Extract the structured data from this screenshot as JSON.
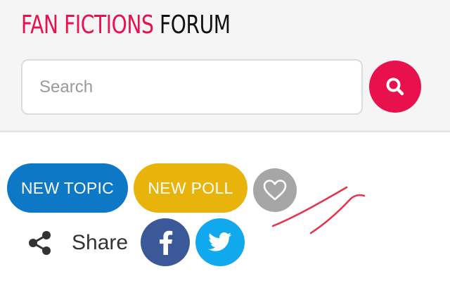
{
  "header": {
    "logo_part1": "FAN FICTIONS",
    "logo_part2": "FORUM",
    "search": {
      "placeholder": "Search",
      "value": ""
    },
    "search_button_icon": "search-icon"
  },
  "actions": {
    "new_topic_label": "NEW TOPIC",
    "new_poll_label": "NEW POLL",
    "favorite_icon": "heart-icon"
  },
  "share": {
    "label": "Share",
    "icon": "share-icon",
    "networks": [
      "facebook-icon",
      "twitter-icon"
    ]
  },
  "colors": {
    "brand_red": "#e8114e",
    "topic_blue": "#0d78c6",
    "poll_yellow": "#e8b40c",
    "favorite_gray": "#a6a6a6",
    "facebook_blue": "#3b5998",
    "twitter_blue": "#10a9ee"
  }
}
